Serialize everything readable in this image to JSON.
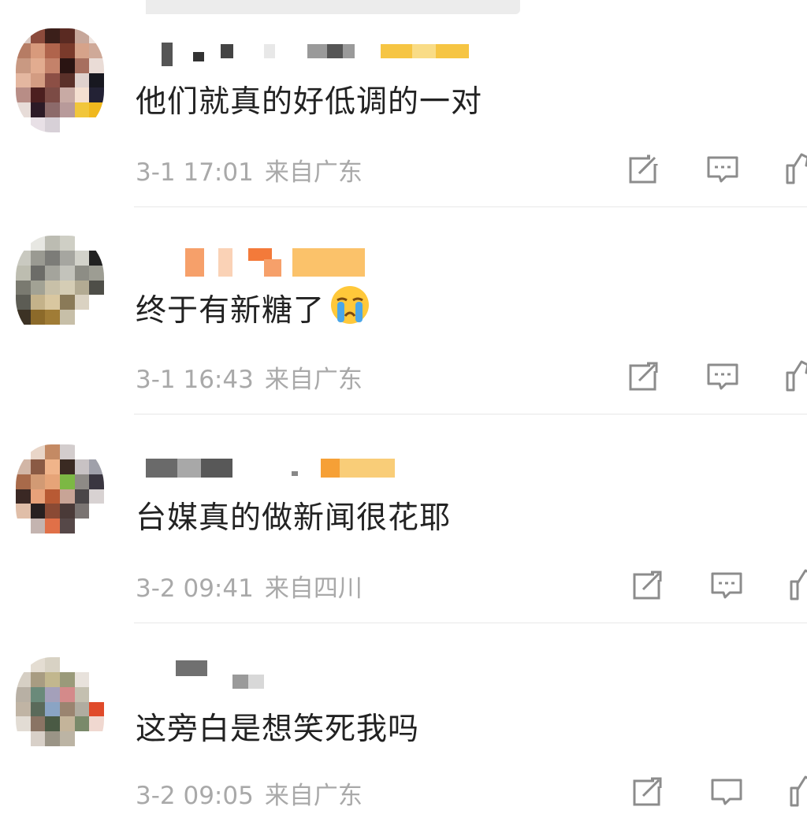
{
  "comments": [
    {
      "text": "他们就真的好低调的一对",
      "time": "3-1 17:01",
      "location": "来自广东",
      "emoji": ""
    },
    {
      "text": "终于有新糖了",
      "time": "3-1 16:43",
      "location": "来自广东",
      "emoji": "crying-face-icon"
    },
    {
      "text": "台媒真的做新闻很花耶",
      "time": "3-2 09:41",
      "location": "来自四川",
      "emoji": ""
    },
    {
      "text": "这旁白是想笑死我吗",
      "time": "3-2 09:05",
      "location": "来自广东",
      "emoji": ""
    }
  ],
  "icons": {
    "share": "share-icon",
    "comment": "comment-icon",
    "like": "thumbs-up-icon"
  },
  "colors": {
    "text": "#222222",
    "meta": "#a9a9a9",
    "icon": "#8c8c8c",
    "divider": "#e8e8e8"
  }
}
